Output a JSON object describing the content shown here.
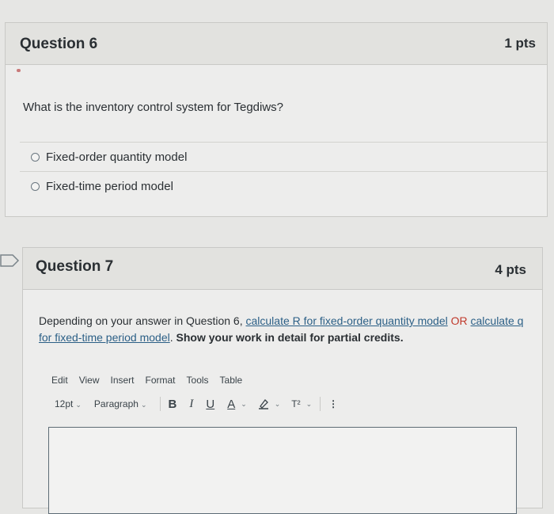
{
  "q6": {
    "title": "Question 6",
    "points": "1 pts",
    "text": "What is the inventory control system for Tegdiws?",
    "answers": [
      "Fixed-order quantity model",
      "Fixed-time period model"
    ]
  },
  "q7": {
    "title": "Question 7",
    "points": "4 pts",
    "text_lead": "Depending on your answer in Question 6, ",
    "link1": "calculate R for fixed-order quantity model",
    "or_text": " OR ",
    "link2": "calculate q for fixed-time period model",
    "period": ".",
    "bold_text": " Show your work in detail for partial credits."
  },
  "editor": {
    "menu": [
      "Edit",
      "View",
      "Insert",
      "Format",
      "Tools",
      "Table"
    ],
    "font_size": "12pt",
    "block_format": "Paragraph",
    "bold": "B",
    "italic": "I",
    "underline": "U",
    "text_color": "A",
    "highlight_icon": "highlighter-icon",
    "superscript": "T²",
    "more": "⋮"
  },
  "colors": {
    "link": "#2b5f86",
    "or": "#c0392b"
  }
}
